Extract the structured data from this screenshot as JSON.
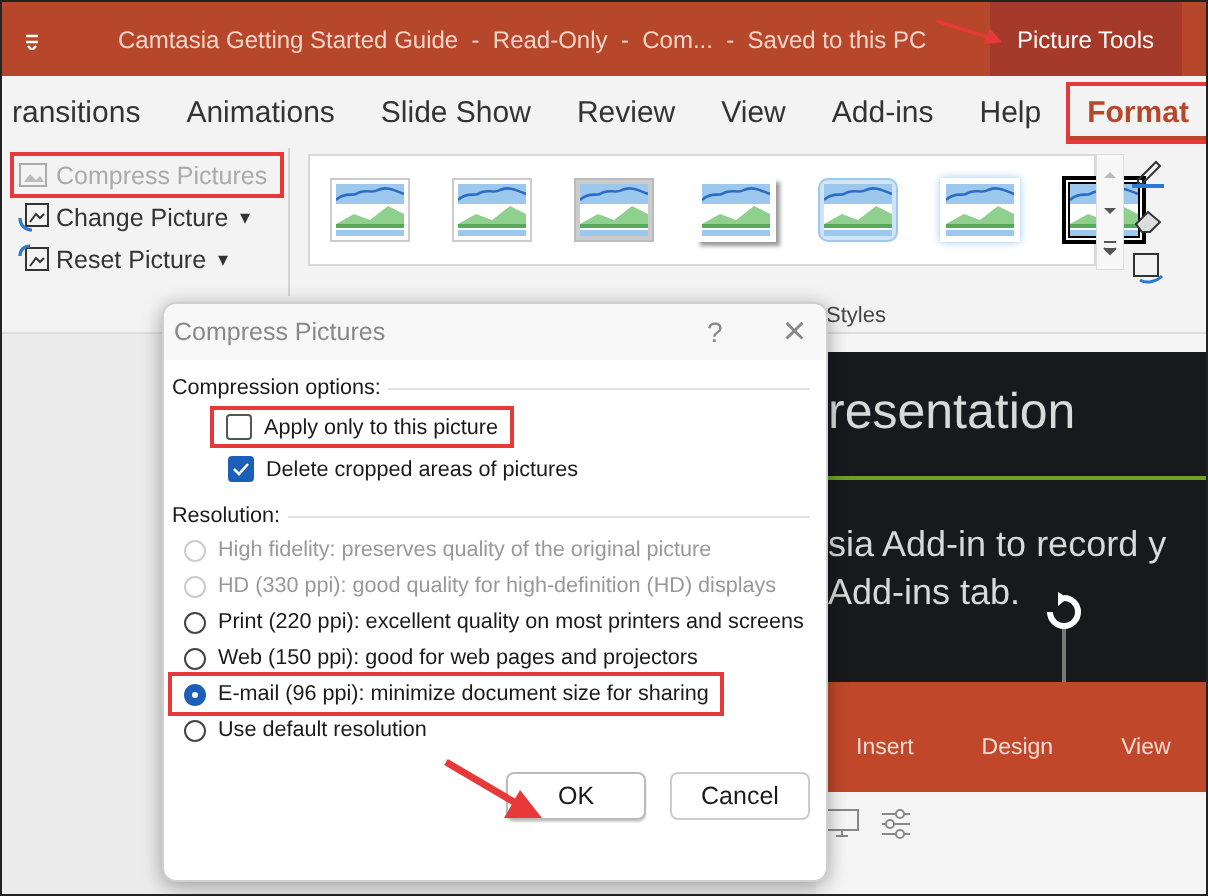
{
  "window": {
    "title": "Camtasia Getting Started Guide  -  Read-Only  -  Com...  -  Saved to this PC",
    "context_tab": "Picture Tools"
  },
  "tabs": [
    {
      "label": "ransitions",
      "selected": false,
      "highlighted": false
    },
    {
      "label": "Animations",
      "selected": false,
      "highlighted": false
    },
    {
      "label": "Slide Show",
      "selected": false,
      "highlighted": false
    },
    {
      "label": "Review",
      "selected": false,
      "highlighted": false
    },
    {
      "label": "View",
      "selected": false,
      "highlighted": false
    },
    {
      "label": "Add-ins",
      "selected": false,
      "highlighted": false
    },
    {
      "label": "Help",
      "selected": false,
      "highlighted": false
    },
    {
      "label": "Format",
      "selected": true,
      "highlighted": true
    }
  ],
  "ribbon": {
    "buttons": [
      {
        "label": "Compress Pictures",
        "disabled": true,
        "highlighted": true
      },
      {
        "label": "Change Picture",
        "disabled": false,
        "highlighted": false,
        "dropdown": "▾"
      },
      {
        "label": "Reset Picture",
        "disabled": false,
        "highlighted": false,
        "dropdown": "▾"
      }
    ],
    "group_label": "Styles"
  },
  "dialog": {
    "title": "Compress Pictures",
    "help": "?",
    "close": "×",
    "compression_label": "Compression options:",
    "checkboxes": [
      {
        "label": "Apply only to this picture",
        "checked": false,
        "highlighted": true
      },
      {
        "label": "Delete cropped areas of pictures",
        "checked": true,
        "highlighted": false
      }
    ],
    "resolution_label": "Resolution:",
    "radios": [
      {
        "label": "High fidelity: preserves quality of the original picture",
        "selected": false,
        "disabled": true,
        "highlighted": false
      },
      {
        "label": "HD (330 ppi): good quality for high-definition (HD) displays",
        "selected": false,
        "disabled": true,
        "highlighted": false
      },
      {
        "label": "Print (220 ppi): excellent quality on most printers and screens",
        "selected": false,
        "disabled": false,
        "highlighted": false
      },
      {
        "label": "Web (150 ppi): good for web pages and projectors",
        "selected": false,
        "disabled": false,
        "highlighted": false
      },
      {
        "label": "E-mail (96 ppi): minimize document size for sharing",
        "selected": true,
        "disabled": false,
        "highlighted": true
      },
      {
        "label": "Use default resolution",
        "selected": false,
        "disabled": false,
        "highlighted": false
      }
    ],
    "buttons": [
      "OK",
      "Cancel"
    ]
  },
  "slide": {
    "title": "resentation",
    "body": [
      "sia Add-in to record y",
      "Add-ins tab."
    ],
    "tabs": [
      "Insert",
      "Design",
      "View"
    ]
  }
}
